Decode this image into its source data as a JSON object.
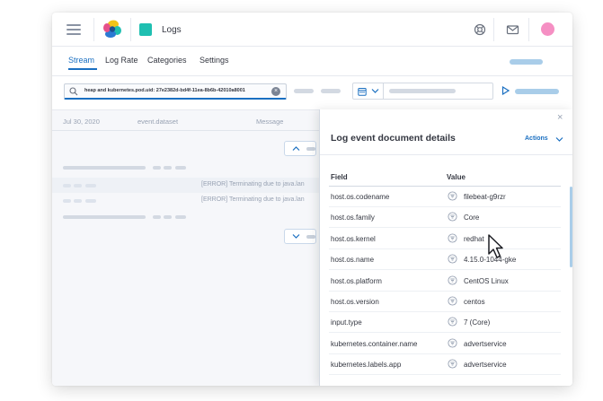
{
  "header": {
    "app_title": "Logs",
    "icons": [
      "menu-icon",
      "elastic-logo",
      "help-icon",
      "mail-icon",
      "user-avatar"
    ],
    "colors": {
      "app_square": "#1fbfb1",
      "avatar": "#f58fc3",
      "accent": "#1a6fc1"
    }
  },
  "tabs": [
    {
      "label": "Stream",
      "active": true
    },
    {
      "label": "Log Rate",
      "active": false
    },
    {
      "label": "Categories",
      "active": false
    },
    {
      "label": "Settings",
      "active": false
    }
  ],
  "search": {
    "value": "heap and kubernetes.pod.uid: 27e2382d-bd4f-11ea-8b6b-42010a8001"
  },
  "stream": {
    "columns": {
      "timestamp": "Jul 30, 2020",
      "dataset": "event.dataset",
      "message": "Message"
    },
    "log_messages": [
      "[ERROR] Terminating due to java.lan",
      "[ERROR] Terminating due to java.lan"
    ]
  },
  "flyout": {
    "title": "Log event document details",
    "actions_label": "Actions",
    "close_label": "×",
    "field_header": "Field",
    "value_header": "Value",
    "rows": [
      {
        "field": "host.os.codename",
        "value": "filebeat-g9rzr"
      },
      {
        "field": "host.os.family",
        "value": "Core"
      },
      {
        "field": "host.os.kernel",
        "value": "redhat"
      },
      {
        "field": "host.os.name",
        "value": "4.15.0-1044-gke"
      },
      {
        "field": "host.os.platform",
        "value": "CentOS Linux"
      },
      {
        "field": "host.os.version",
        "value": "centos"
      },
      {
        "field": "input.type",
        "value": "7 (Core)"
      },
      {
        "field": "kubernetes.container.name",
        "value": "advertservice"
      },
      {
        "field": "kubernetes.labels.app",
        "value": "advertservice"
      }
    ]
  }
}
